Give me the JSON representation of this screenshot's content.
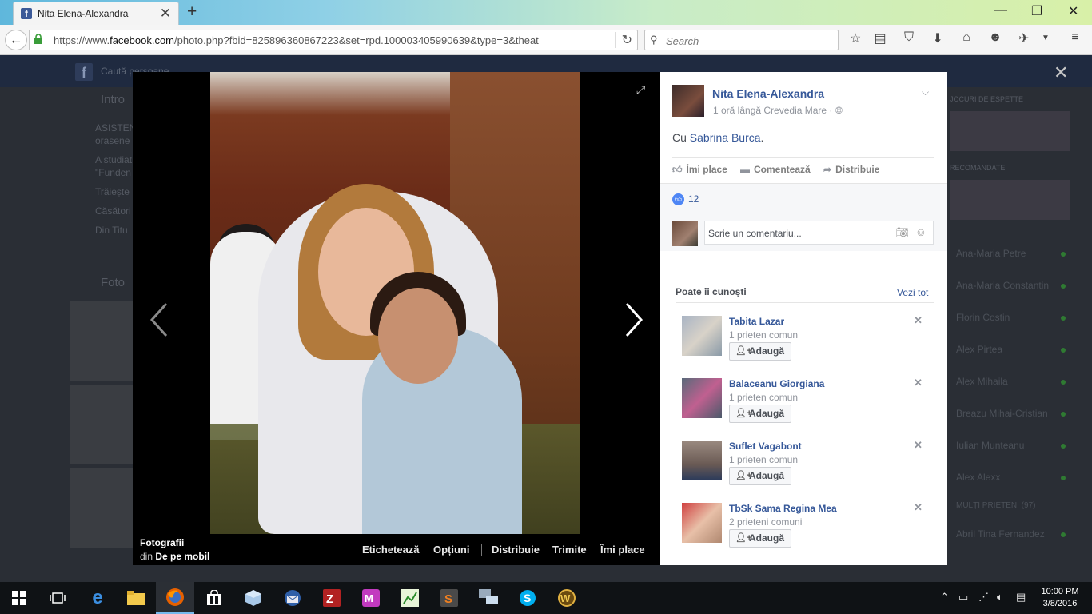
{
  "browser": {
    "tab_title": "Nita Elena-Alexandra",
    "tab_favicon": "f",
    "url_prefix": "https://www.",
    "url_domain": "facebook.com",
    "url_rest": "/photo.php?fbid=825896360867223&set=rpd.100003405990639&type=3&theat",
    "search_placeholder": "Search"
  },
  "background": {
    "search_placeholder": "Caută persoane",
    "intro": "Intro",
    "items": [
      "ASISTEN",
      "orasene",
      "A studiat",
      "\"Funden",
      "Trăiește",
      "Căsători",
      "Din Titu"
    ],
    "photos": "Foto",
    "games_label_1": "JOCURI DE ESPETTE",
    "games_label_2": "RECOMANDATE",
    "chat": [
      "Ana-Maria Petre",
      "Ana-Maria Constantin",
      "Florin Costin",
      "Alex Pirtea",
      "Alex Mihaila",
      "Breazu Mihai-Cristian",
      "Iulian Munteanu",
      "Alex Alexx",
      "MULȚI PRIETENI (97)",
      "Abril Tina Fernandez"
    ]
  },
  "viewer": {
    "caption_title": "Fotografii",
    "caption_from": "din",
    "caption_album": "De pe mobil",
    "actions": [
      "Etichetează",
      "Opțiuni",
      "Distribuie",
      "Trimite",
      "Îmi place"
    ]
  },
  "post": {
    "author": "Nita Elena-Alexandra",
    "time": "1 oră lângă Crevedia Mare",
    "with_prefix": "Cu",
    "with_name": "Sabrina Burca",
    "with_suffix": ".",
    "like_label": "Îmi place",
    "comment_label": "Comentează",
    "share_label": "Distribuie",
    "likes_count": "12",
    "comment_placeholder": "Scrie un comentariu..."
  },
  "pymk": {
    "title": "Poate îi cunoști",
    "see_all": "Vezi tot",
    "add_label": "Adaugă",
    "people": [
      {
        "name": "Tabita Lazar",
        "mutual": "1 prieten comun"
      },
      {
        "name": "Balaceanu Giorgiana",
        "mutual": "1 prieten comun"
      },
      {
        "name": "Suflet Vagabont",
        "mutual": "1 prieten comun"
      },
      {
        "name": "TbSk Sama Regina Mea",
        "mutual": "2 prieteni comuni"
      }
    ]
  },
  "taskbar": {
    "time": "10:00 PM",
    "date": "3/8/2016"
  },
  "colors": {
    "fb_link": "#365899",
    "like_blue": "#4e86f5"
  }
}
